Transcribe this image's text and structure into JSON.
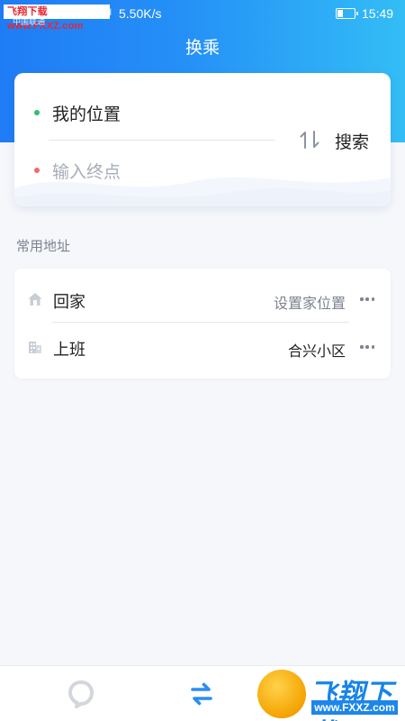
{
  "status_bar": {
    "watermark": "飞翔下载 www.FXXZ.com",
    "carrier": "中国联通",
    "signal": "ıııl ıııl",
    "speed": "5.50K/s",
    "battery_level": 0.35,
    "time": "15:49"
  },
  "header": {
    "title": "换乘"
  },
  "route": {
    "from": "我的位置",
    "to_placeholder": "输入终点",
    "search_label": "搜索"
  },
  "frequent": {
    "section_title": "常用地址",
    "items": [
      {
        "label": "回家",
        "value": "设置家位置",
        "icon": "home-icon"
      },
      {
        "label": "上班",
        "value": "合兴小区",
        "icon": "building-icon"
      }
    ]
  },
  "bottom_nav": {
    "tabs": [
      {
        "icon": "map-pin-icon",
        "active": false
      },
      {
        "icon": "transfer-icon",
        "active": true
      }
    ]
  },
  "watermark_logo": {
    "title": "飞翔下载",
    "url": "www.FXXZ.com"
  },
  "colors": {
    "header_start": "#1f7cf5",
    "header_end": "#33bdf5",
    "accent": "#2b8df5",
    "from_dot": "#28c36b",
    "to_dot": "#f06a6a"
  }
}
